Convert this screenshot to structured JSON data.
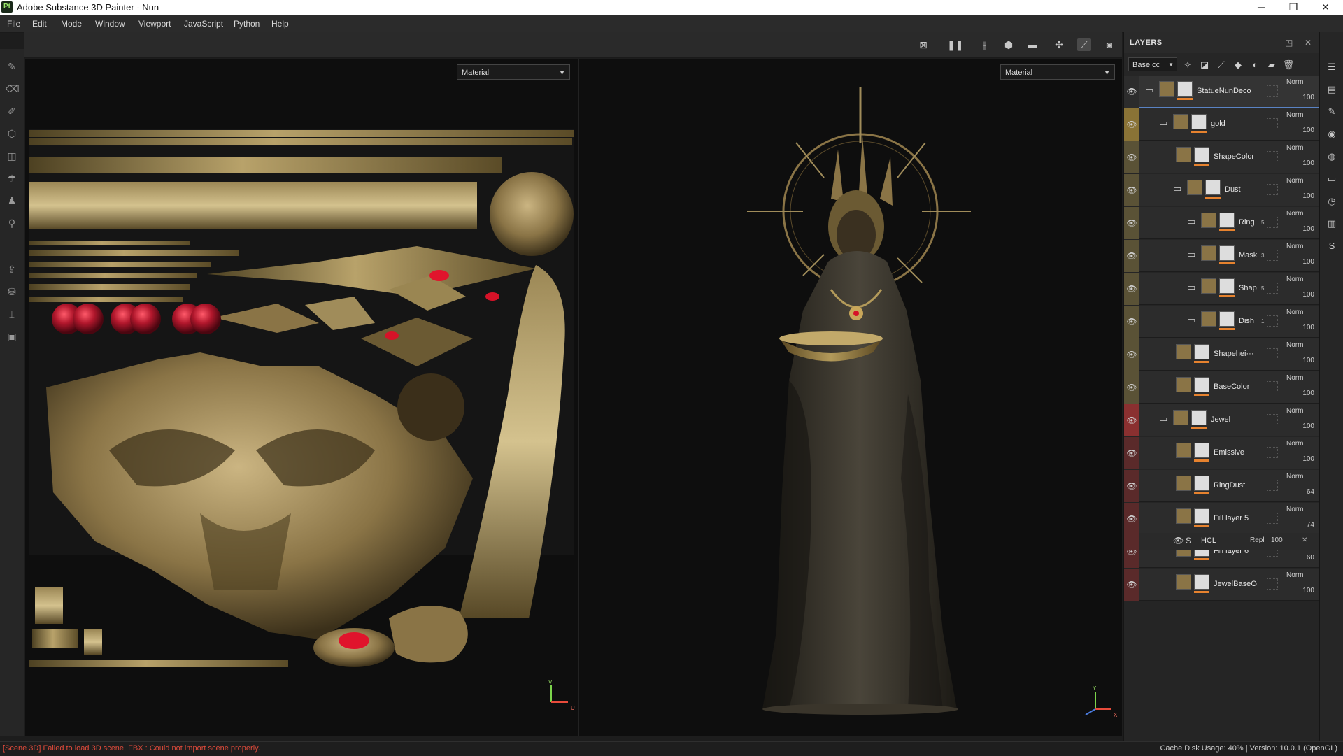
{
  "window": {
    "title": "Adobe Substance 3D Painter - Nun",
    "app_icon": "Pt"
  },
  "menu": [
    "File",
    "Edit",
    "Mode",
    "Window",
    "Viewport",
    "JavaScript",
    "Python",
    "Help"
  ],
  "viewport": {
    "left_mode": "Material",
    "right_mode": "Material",
    "uv_gizmo": {
      "v": "V",
      "u": "U"
    },
    "axis_gizmo": {
      "y": "Y",
      "x": "X"
    }
  },
  "layers_panel": {
    "title": "LAYERS",
    "channel": "Base cc",
    "layers": [
      {
        "name": "StatueNunDeco",
        "blend": "Norm",
        "opacity": "100",
        "color": "",
        "indent": 0,
        "folder": true,
        "selected": true,
        "count": ""
      },
      {
        "name": "gold",
        "blend": "Norm",
        "opacity": "100",
        "color": "#8a7336",
        "indent": 1,
        "folder": true,
        "selected": false,
        "count": ""
      },
      {
        "name": "ShapeColor",
        "blend": "Norm",
        "opacity": "100",
        "color": "#5a5236",
        "indent": 2,
        "folder": false,
        "selected": false,
        "count": ""
      },
      {
        "name": "Dust",
        "blend": "Norm",
        "opacity": "100",
        "color": "#5a5236",
        "indent": 2,
        "folder": true,
        "selected": false,
        "count": ""
      },
      {
        "name": "Ring",
        "blend": "Norm",
        "opacity": "100",
        "color": "#5a5236",
        "indent": 3,
        "folder": true,
        "selected": false,
        "count": "5"
      },
      {
        "name": "Mask",
        "blend": "Norm",
        "opacity": "100",
        "color": "#5a5236",
        "indent": 3,
        "folder": true,
        "selected": false,
        "count": "3"
      },
      {
        "name": "Shape",
        "blend": "Norm",
        "opacity": "100",
        "color": "#5a5236",
        "indent": 3,
        "folder": true,
        "selected": false,
        "count": "5"
      },
      {
        "name": "Dish",
        "blend": "Norm",
        "opacity": "100",
        "color": "#5a5236",
        "indent": 3,
        "folder": true,
        "selected": false,
        "count": "1"
      },
      {
        "name": "Shapehei···",
        "blend": "Norm",
        "opacity": "100",
        "color": "#5a5236",
        "indent": 2,
        "folder": false,
        "selected": false,
        "count": ""
      },
      {
        "name": "BaseColor",
        "blend": "Norm",
        "opacity": "100",
        "color": "#5a5236",
        "indent": 2,
        "folder": false,
        "selected": false,
        "count": ""
      },
      {
        "name": "Jewel",
        "blend": "Norm",
        "opacity": "100",
        "color": "#8a3030",
        "indent": 1,
        "folder": true,
        "selected": false,
        "count": ""
      },
      {
        "name": "Emissive",
        "blend": "Norm",
        "opacity": "100",
        "color": "#5a2a2a",
        "indent": 2,
        "folder": false,
        "selected": false,
        "count": ""
      },
      {
        "name": "RingDust",
        "blend": "Norm",
        "opacity": "64",
        "color": "#5a2a2a",
        "indent": 2,
        "folder": false,
        "selected": false,
        "count": ""
      },
      {
        "name": "Fill layer 5",
        "blend": "Norm",
        "opacity": "74",
        "color": "#5a2a2a",
        "indent": 2,
        "folder": false,
        "selected": false,
        "count": ""
      },
      {
        "name": "Fill layer 6",
        "blend": "Norm",
        "opacity": "60",
        "color": "#5a2a2a",
        "indent": 2,
        "folder": false,
        "selected": false,
        "count": ""
      },
      {
        "name": "JewelBaseColor",
        "blend": "Norm",
        "opacity": "100",
        "color": "#5a2a2a",
        "indent": 2,
        "folder": false,
        "selected": false,
        "count": ""
      }
    ],
    "effect": {
      "name": "HCL",
      "blend": "Repl",
      "opacity": "100"
    }
  },
  "status": {
    "error": "[Scene 3D] Failed to load 3D scene, FBX : Could not import scene properly.",
    "cache": "Cache Disk Usage:  40% | Version: 10.0.1 (OpenGL)"
  },
  "colors": {
    "accent_selected": "#5a83c4",
    "error_text": "#e24b3b",
    "gold_band": "#8a7336",
    "jewel_band": "#8a3030"
  }
}
